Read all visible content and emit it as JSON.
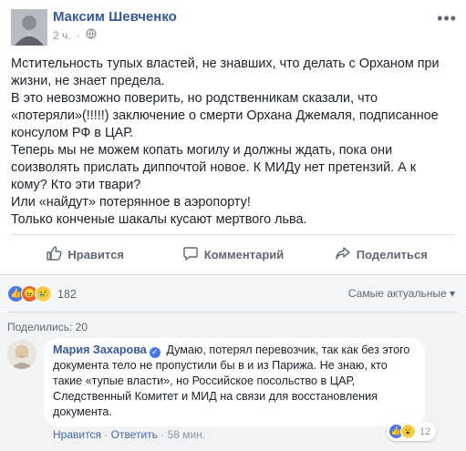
{
  "post": {
    "author": "Максим Шевченко",
    "time": "2 ч.",
    "privacy_icon": "globe-icon",
    "paragraphs": [
      "Мстительность тупых властей, не знавших, что делать с Орханом при жизни, не знает предела.",
      "В это невозможно поверить, но родственникам сказали, что «потеряли»(!!!!!) заключение о смерти Орхана Джемаля, подписанное консулом РФ в ЦАР.",
      "Теперь мы не можем копать могилу и должны ждать, пока они соизволять прислать диппочтой новое. К МИДу нет претензий. А к кому? Кто эти твари?",
      "Или «найдут» потерянное в аэропорту!",
      "Только конченые шакалы кусают мертвого льва."
    ]
  },
  "actions": {
    "like": "Нравится",
    "comment": "Комментарий",
    "share": "Поделиться"
  },
  "summary": {
    "reaction_count": "182",
    "sort_label": "Самые актуальные",
    "shares": "Поделились: 20"
  },
  "comment": {
    "author": "Мария Захарова",
    "text": "Думаю, потерял перевозчик, так как без этого документа тело не пропустили бы в и из Парижа. Не знаю, кто такие «тупые власти», но Российское посольство в ЦАР, Следственный Комитет и МИД на связи для восстановления документа.",
    "like": "Нравится",
    "reply": "Ответить",
    "time": "58 мин.",
    "reaction_count": "12"
  },
  "colors": {
    "link": "#365899",
    "muted": "#90949c",
    "like_blue": "#4a76f0"
  }
}
